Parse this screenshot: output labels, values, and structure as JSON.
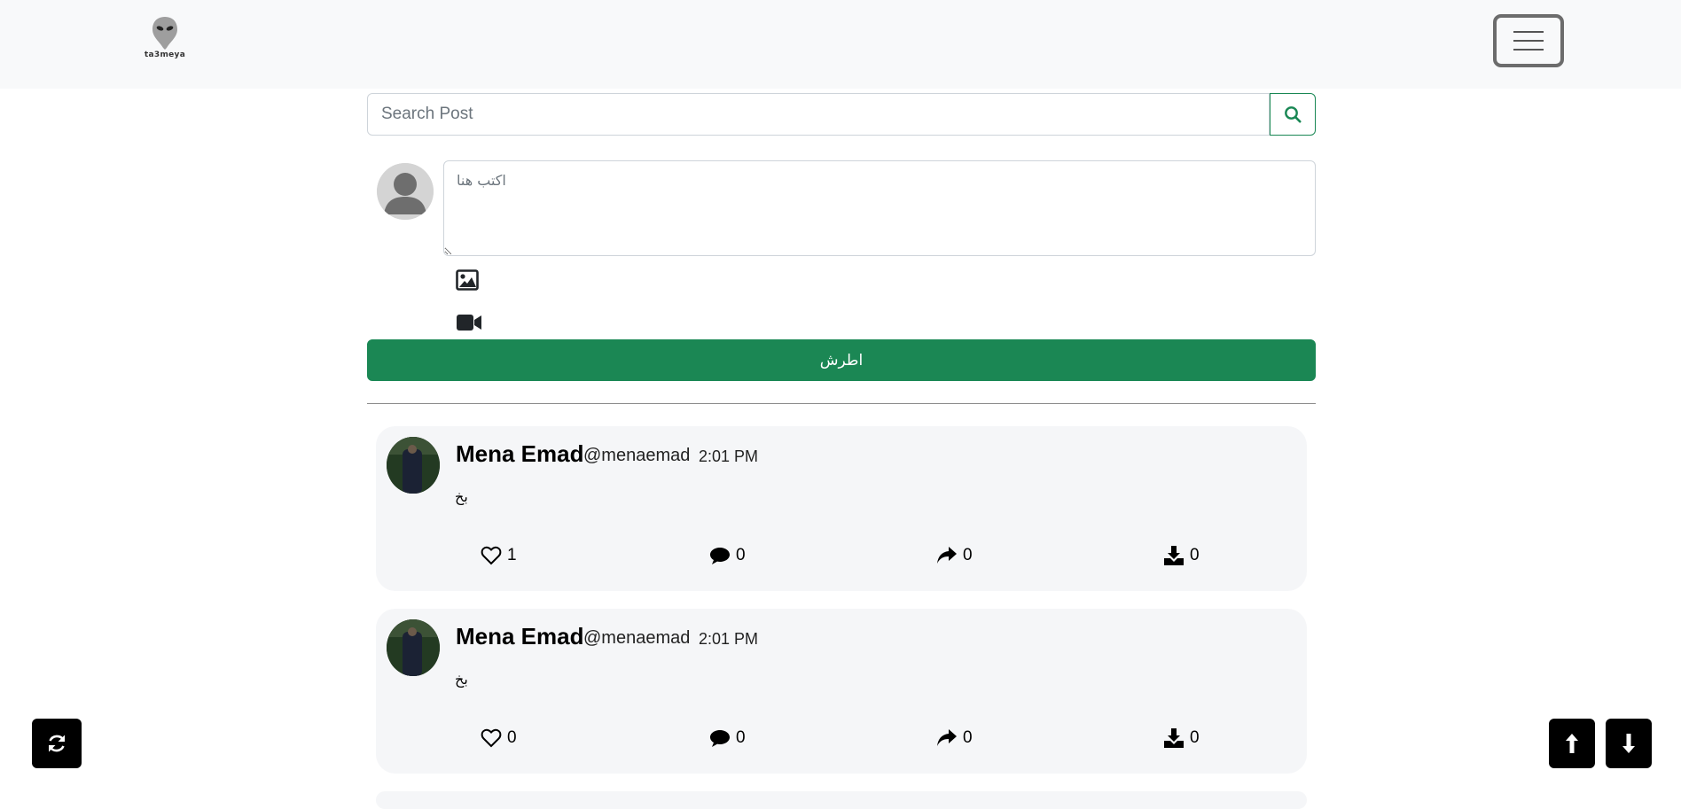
{
  "header": {
    "logo_text": "ta3meya",
    "menu_icon": "hamburger-icon"
  },
  "search": {
    "placeholder": "Search Post",
    "value": "",
    "button_icon": "search-icon"
  },
  "composer": {
    "placeholder": "اكتب هنا",
    "avatar_icon": "default-user-icon",
    "image_icon": "image-icon",
    "video_icon": "video-icon",
    "submit_label": "اطرش"
  },
  "posts": [
    {
      "name": "Mena Emad",
      "handle": "@menaemad",
      "time": "2:01 PM",
      "body": "بخ",
      "likes": "1",
      "comments": "0",
      "shares": "0",
      "downloads": "0"
    },
    {
      "name": "Mena Emad",
      "handle": "@menaemad",
      "time": "2:01 PM",
      "body": "بخ",
      "likes": "0",
      "comments": "0",
      "shares": "0",
      "downloads": "0"
    }
  ],
  "floating": {
    "refresh_icon": "refresh-icon",
    "scroll_up_icon": "arrow-up-icon",
    "scroll_down_icon": "arrow-down-icon"
  },
  "colors": {
    "primary_green": "#198754",
    "navbar_bg": "#f8f9fa",
    "post_bg": "#f5f6f8"
  }
}
